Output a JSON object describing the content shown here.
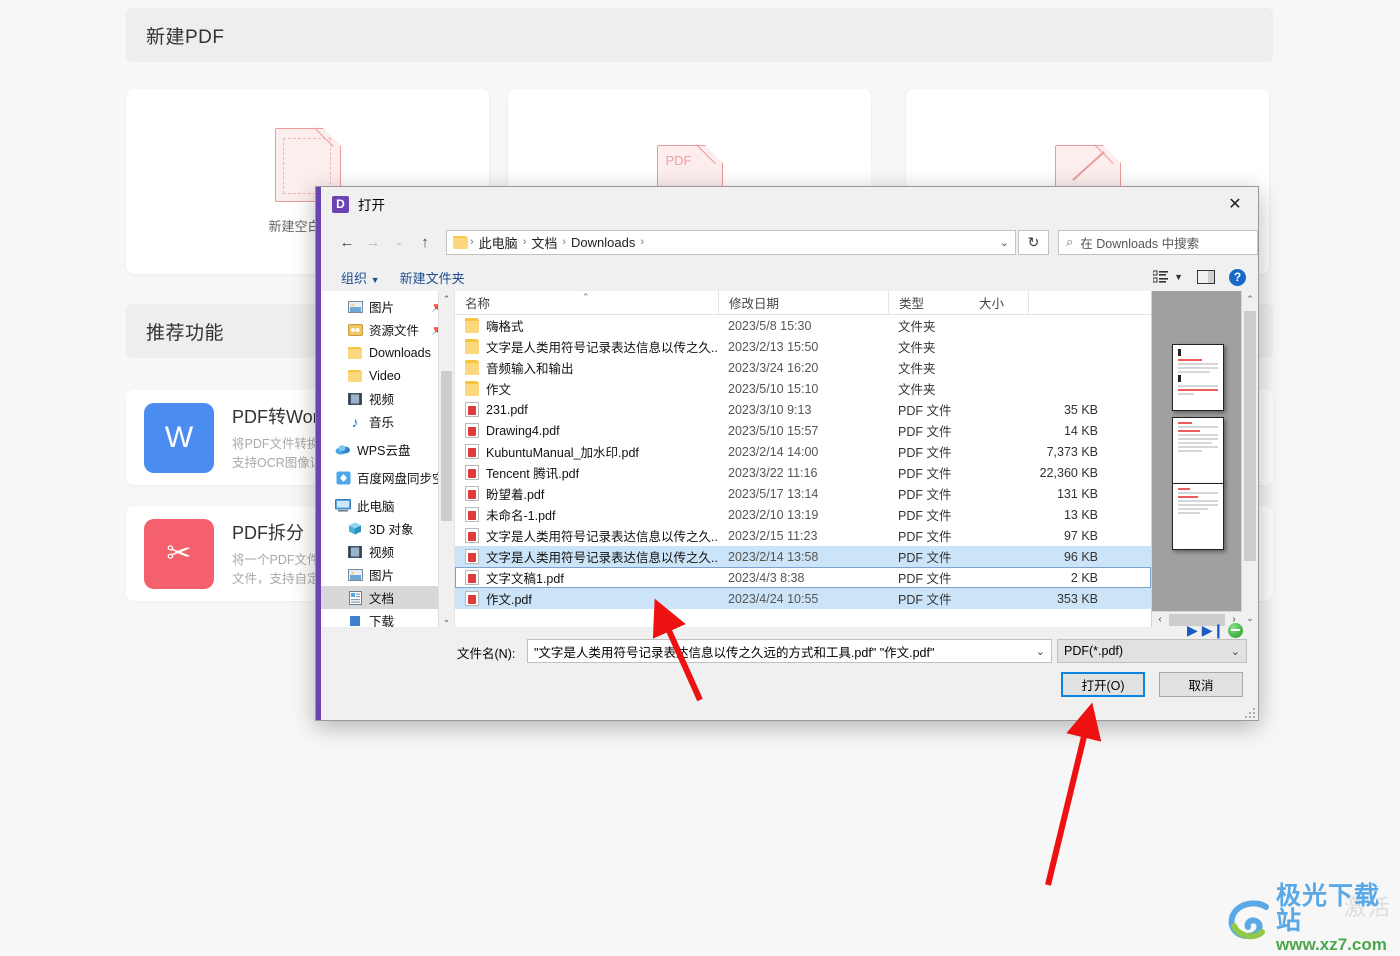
{
  "background_app": {
    "section_new": "新建PDF",
    "section_recommend": "推荐功能",
    "cards": [
      {
        "caption": "新建空白文档",
        "icon": "blank-pdf-icon"
      },
      {
        "caption": "",
        "icon": "pdf-folder-icon"
      },
      {
        "caption": "",
        "icon": "pdf-scan-icon"
      }
    ],
    "features": [
      {
        "icon": "pdf-to-word-icon",
        "color": "#4a8cf0",
        "title": "PDF转Word",
        "desc_line1": "将PDF文件转换为Word文档",
        "desc_line2": "支持OCR图像识别"
      },
      {
        "icon": "pdf-split-icon",
        "color": "#f4606c",
        "title": "PDF拆分",
        "desc_line1": "将一个PDF文件拆分为多个",
        "desc_line2": "文件，支持自定义拆分"
      }
    ]
  },
  "dialog": {
    "title": "打开",
    "app_badge": "D",
    "close_icon": "close-icon",
    "accent_color": "#6b43b3",
    "nav": {
      "back_icon": "arrow-left-icon",
      "forward_icon": "arrow-right-icon",
      "history_icon": "chevron-down-icon",
      "up_icon": "arrow-up-icon",
      "refresh_icon": "refresh-icon",
      "breadcrumb": [
        "此电脑",
        "文档",
        "Downloads"
      ],
      "breadcrumb_caret": "⌄"
    },
    "search": {
      "icon": "search-icon",
      "placeholder": "在 Downloads 中搜索"
    },
    "toolbar": {
      "organize": "组织",
      "organize_caret": "▼",
      "new_folder": "新建文件夹",
      "view_icon": "view-list-icon",
      "view_caret": "▼",
      "pane_icon": "preview-pane-icon",
      "help_icon": "help-icon",
      "help_label": "?"
    },
    "tree": [
      {
        "label": "图片",
        "icon": "picture-icon",
        "indent": true,
        "pinned": true
      },
      {
        "label": "资源文件",
        "icon": "resource-folder-icon",
        "indent": true,
        "pinned": true
      },
      {
        "label": "Downloads",
        "icon": "folder-icon",
        "indent": true,
        "pinned": false
      },
      {
        "label": "Video",
        "icon": "folder-icon",
        "indent": true,
        "pinned": false
      },
      {
        "label": "视频",
        "icon": "video-icon",
        "indent": true,
        "pinned": false
      },
      {
        "label": "音乐",
        "icon": "music-icon",
        "indent": true,
        "pinned": false
      },
      {
        "label": "WPS云盘",
        "icon": "cloud-icon",
        "indent": false,
        "pinned": false
      },
      {
        "label": "百度网盘同步空间",
        "icon": "baidu-netdisk-icon",
        "indent": false,
        "pinned": false
      },
      {
        "label": "此电脑",
        "icon": "this-pc-icon",
        "indent": false,
        "pinned": false
      },
      {
        "label": "3D 对象",
        "icon": "3d-objects-icon",
        "indent": true,
        "pinned": false
      },
      {
        "label": "视频",
        "icon": "video-icon",
        "indent": true,
        "pinned": false
      },
      {
        "label": "图片",
        "icon": "picture-icon",
        "indent": true,
        "pinned": false
      },
      {
        "label": "文档",
        "icon": "documents-icon",
        "indent": true,
        "pinned": false,
        "selected": true
      },
      {
        "label": "下载",
        "icon": "downloads-icon",
        "indent": true,
        "pinned": false
      }
    ],
    "columns": {
      "name": "名称",
      "date": "修改日期",
      "type": "类型",
      "size": "大小",
      "sort_indicator": "⌃"
    },
    "files": [
      {
        "name": "嗨格式",
        "date": "2023/5/8 15:30",
        "type": "文件夹",
        "size": "",
        "icon": "folder-icon",
        "state": ""
      },
      {
        "name": "文字是人类用符号记录表达信息以传之久...",
        "date": "2023/2/13 15:50",
        "type": "文件夹",
        "size": "",
        "icon": "folder-icon",
        "state": ""
      },
      {
        "name": "音频输入和输出",
        "date": "2023/3/24 16:20",
        "type": "文件夹",
        "size": "",
        "icon": "folder-icon",
        "state": ""
      },
      {
        "name": "作文",
        "date": "2023/5/10 15:10",
        "type": "文件夹",
        "size": "",
        "icon": "folder-icon",
        "state": ""
      },
      {
        "name": "231.pdf",
        "date": "2023/3/10 9:13",
        "type": "PDF 文件",
        "size": "35 KB",
        "icon": "pdf-file-icon",
        "state": ""
      },
      {
        "name": "Drawing4.pdf",
        "date": "2023/5/10 15:57",
        "type": "PDF 文件",
        "size": "14 KB",
        "icon": "pdf-file-icon",
        "state": ""
      },
      {
        "name": "KubuntuManual_加水印.pdf",
        "date": "2023/2/14 14:00",
        "type": "PDF 文件",
        "size": "7,373 KB",
        "icon": "pdf-file-icon",
        "state": ""
      },
      {
        "name": "Tencent 腾讯.pdf",
        "date": "2023/3/22 11:16",
        "type": "PDF 文件",
        "size": "22,360 KB",
        "icon": "pdf-file-icon",
        "state": ""
      },
      {
        "name": "盼望着.pdf",
        "date": "2023/5/17 13:14",
        "type": "PDF 文件",
        "size": "131 KB",
        "icon": "pdf-file-icon",
        "state": ""
      },
      {
        "name": "未命名-1.pdf",
        "date": "2023/2/10 13:19",
        "type": "PDF 文件",
        "size": "13 KB",
        "icon": "pdf-file-icon",
        "state": ""
      },
      {
        "name": "文字是人类用符号记录表达信息以传之久...",
        "date": "2023/2/15 11:23",
        "type": "PDF 文件",
        "size": "97 KB",
        "icon": "pdf-file-icon",
        "state": ""
      },
      {
        "name": "文字是人类用符号记录表达信息以传之久...",
        "date": "2023/2/14 13:58",
        "type": "PDF 文件",
        "size": "96 KB",
        "icon": "pdf-file-icon",
        "state": "selected"
      },
      {
        "name": "文字文稿1.pdf",
        "date": "2023/4/3 8:38",
        "type": "PDF 文件",
        "size": "2 KB",
        "icon": "pdf-file-icon",
        "state": "focus-white"
      },
      {
        "name": "作文.pdf",
        "date": "2023/4/24 10:55",
        "type": "PDF 文件",
        "size": "353 KB",
        "icon": "pdf-file-icon",
        "state": "selected"
      }
    ],
    "preview": {
      "thumbnail_count": 3,
      "scroll_up_icon": "chevron-up-icon",
      "scroll_down_icon": "chevron-down-icon",
      "hscroll_left_icon": "chevron-left-icon",
      "hscroll_right_icon": "chevron-right-icon"
    },
    "media_controls": {
      "play_icon": "play-icon",
      "next_icon": "next-track-icon",
      "stop_icon": "stop-icon"
    },
    "footer": {
      "filename_label": "文件名(N):",
      "filename_value": "\"文字是人类用符号记录表达信息以传之久远的方式和工具.pdf\" \"作文.pdf\"",
      "filename_caret": "⌄",
      "filetype_value": "PDF(*.pdf)",
      "filetype_caret": "⌄",
      "open_button": "打开(O)",
      "cancel_button": "取消"
    }
  },
  "annotations": {
    "arrow_color": "#ee1111",
    "arrow1": "points-to-selected-file-row",
    "arrow2": "points-to-open-button"
  },
  "watermarks": {
    "activate_text": "激活",
    "logo_cn": "极光下载站",
    "logo_url": "www.xz7.com",
    "logo_blue": "#5aa9e6",
    "logo_green": "#4ca64c"
  }
}
